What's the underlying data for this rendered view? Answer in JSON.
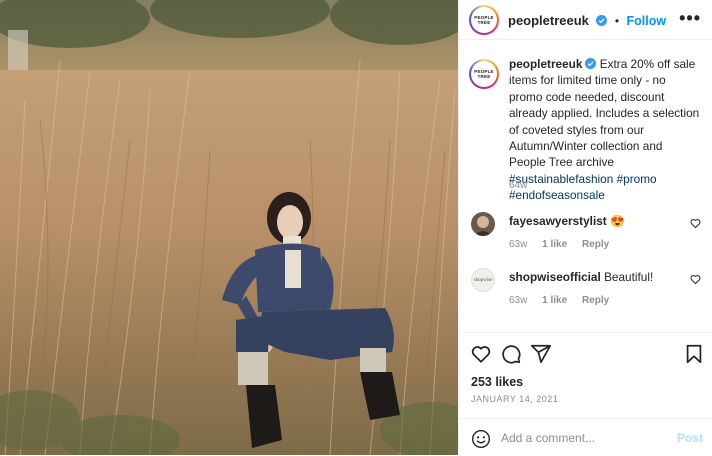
{
  "account": {
    "username": "peopletreeuk",
    "verified": true,
    "follow_label": "Follow",
    "separator": "•",
    "more_label": "•••",
    "logo_text_line1": "PEOPLE",
    "logo_text_line2": "TREE"
  },
  "caption": {
    "username": "peopletreeuk",
    "text": "Extra 20% off sale items for limited time only - no promo code needed, discount already applied. Includes a selection of coveted styles from our Autumn/Winter collection and People Tree archive",
    "hashtags": [
      "#sustainablefashion",
      "#promo",
      "#endofseasonsale"
    ],
    "age": "64w"
  },
  "comments": [
    {
      "username": "fayesawyerstylist",
      "text": "😍",
      "age": "63w",
      "likes": "1 like",
      "reply": "Reply",
      "avatar": "person-avatar"
    },
    {
      "username": "shopwiseofficial",
      "text": "Beautiful!",
      "age": "63w",
      "likes": "1 like",
      "reply": "Reply",
      "avatar": "shopwise-logo",
      "avatar_text": "shopwise"
    }
  ],
  "actions": {
    "icons": [
      "heart-icon",
      "comment-icon",
      "share-icon",
      "bookmark-icon"
    ],
    "likes": "253 likes",
    "date": "JANUARY 14, 2021"
  },
  "comment_box": {
    "placeholder": "Add a comment...",
    "post_label": "Post"
  },
  "colors": {
    "link_blue": "#0095f6",
    "hashtag": "#00376b",
    "muted": "#8e8e8e",
    "post_disabled": "#b2dffc"
  }
}
